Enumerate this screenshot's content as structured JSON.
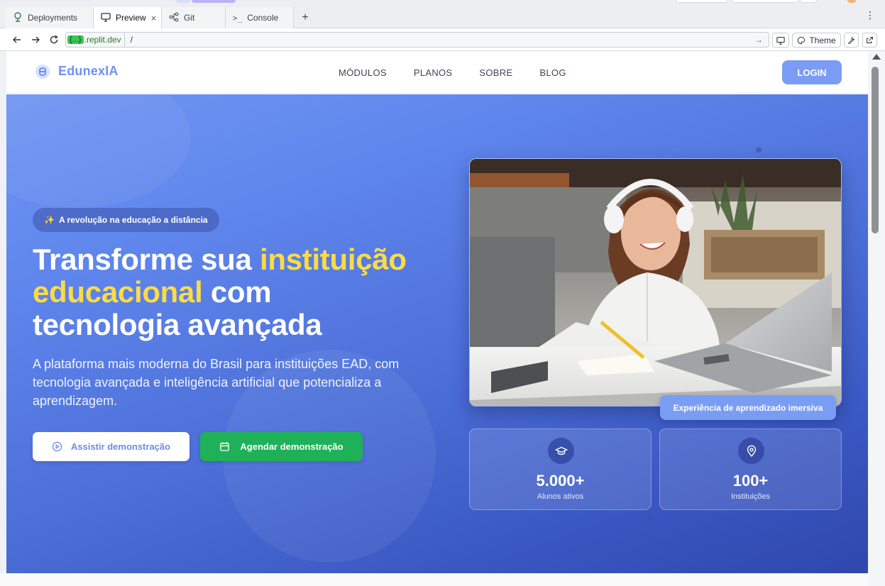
{
  "workspace": {
    "tabs": [
      {
        "label": "Deployments",
        "icon": "deploy-icon"
      },
      {
        "label": "Preview",
        "icon": "monitor-icon",
        "active": true,
        "close": "×"
      },
      {
        "label": "Git",
        "icon": "git-icon"
      },
      {
        "label": "Console",
        "icon": "terminal-icon"
      }
    ],
    "add_tab": "+",
    "menu": "⋮"
  },
  "urlbar": {
    "host_mask": "{...}",
    "host": ".replit.dev",
    "path": "/",
    "go": "→",
    "theme_label": "Theme"
  },
  "site": {
    "brand": "EdunexIA",
    "nav": [
      "MÓDULOS",
      "PLANOS",
      "SOBRE",
      "BLOG"
    ],
    "login": "LOGIN"
  },
  "hero": {
    "pill": "A revolução na educação a distância",
    "pill_icon": "✨",
    "headline_1": "Transforme sua ",
    "headline_hl_1": "instituição",
    "headline_hl_2": "educacional",
    "headline_2": " com",
    "headline_3": "tecnologia avançada",
    "lead": "A plataforma mais moderna do Brasil para instituições EAD, com tecnologia avançada e inteligência artificial que potencializa a aprendizagem.",
    "btn_demo": "Assistir demonstração",
    "btn_schedule": "Agendar demonstração",
    "caption": "Experiência de aprendizado imersiva",
    "stats": [
      {
        "value": "5.000+",
        "label": "Alunos ativos",
        "icon": "graduation-cap-icon"
      },
      {
        "value": "100+",
        "label": "Instituições",
        "icon": "map-pin-icon"
      }
    ]
  },
  "colors": {
    "brand": "#6e93f0",
    "highlight": "#fbdc45",
    "cta_green": "#1fb157",
    "login_bg": "#7b9cf5"
  }
}
